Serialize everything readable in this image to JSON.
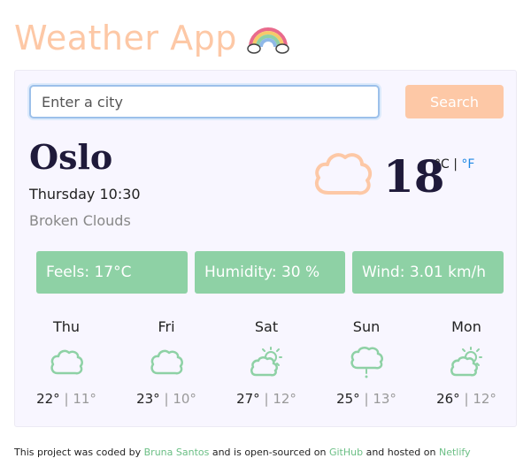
{
  "app": {
    "title": "Weather App"
  },
  "search": {
    "placeholder": "Enter a city",
    "value": "",
    "button_label": "Search"
  },
  "current": {
    "city": "Oslo",
    "datetime": "Thursday 10:30",
    "description": "Broken Clouds",
    "temperature": "18",
    "unit_celsius": "°C",
    "unit_separator": "|",
    "unit_fahrenheit": "°F",
    "icon": "cloud-icon"
  },
  "stats": {
    "feels": "Feels: 17°C",
    "humidity": "Humidity: 30 %",
    "wind": "Wind: 3.01 km/h"
  },
  "forecast": [
    {
      "day": "Thu",
      "max": "22°",
      "sep": "|",
      "min": "11°",
      "icon": "cloud-icon"
    },
    {
      "day": "Fri",
      "max": "23°",
      "sep": "|",
      "min": "10°",
      "icon": "cloud-icon"
    },
    {
      "day": "Sat",
      "max": "27°",
      "sep": "|",
      "min": "12°",
      "icon": "partly-sunny-icon"
    },
    {
      "day": "Sun",
      "max": "25°",
      "sep": "|",
      "min": "13°",
      "icon": "rain-icon"
    },
    {
      "day": "Mon",
      "max": "26°",
      "sep": "|",
      "min": "12°",
      "icon": "partly-sunny-icon"
    }
  ],
  "footer": {
    "text1": "This project was coded by",
    "author": "Bruna Santos",
    "text2": "and is open-sourced on",
    "github": "GitHub",
    "text3": "and hosted on",
    "netlify": "Netlify"
  },
  "colors": {
    "accent_peach": "#fdc8a6",
    "stat_green": "#8ed1a5",
    "link_blue": "#1e88e5",
    "footer_link": "#6bbf85",
    "card_bg": "#f8f6ff"
  }
}
